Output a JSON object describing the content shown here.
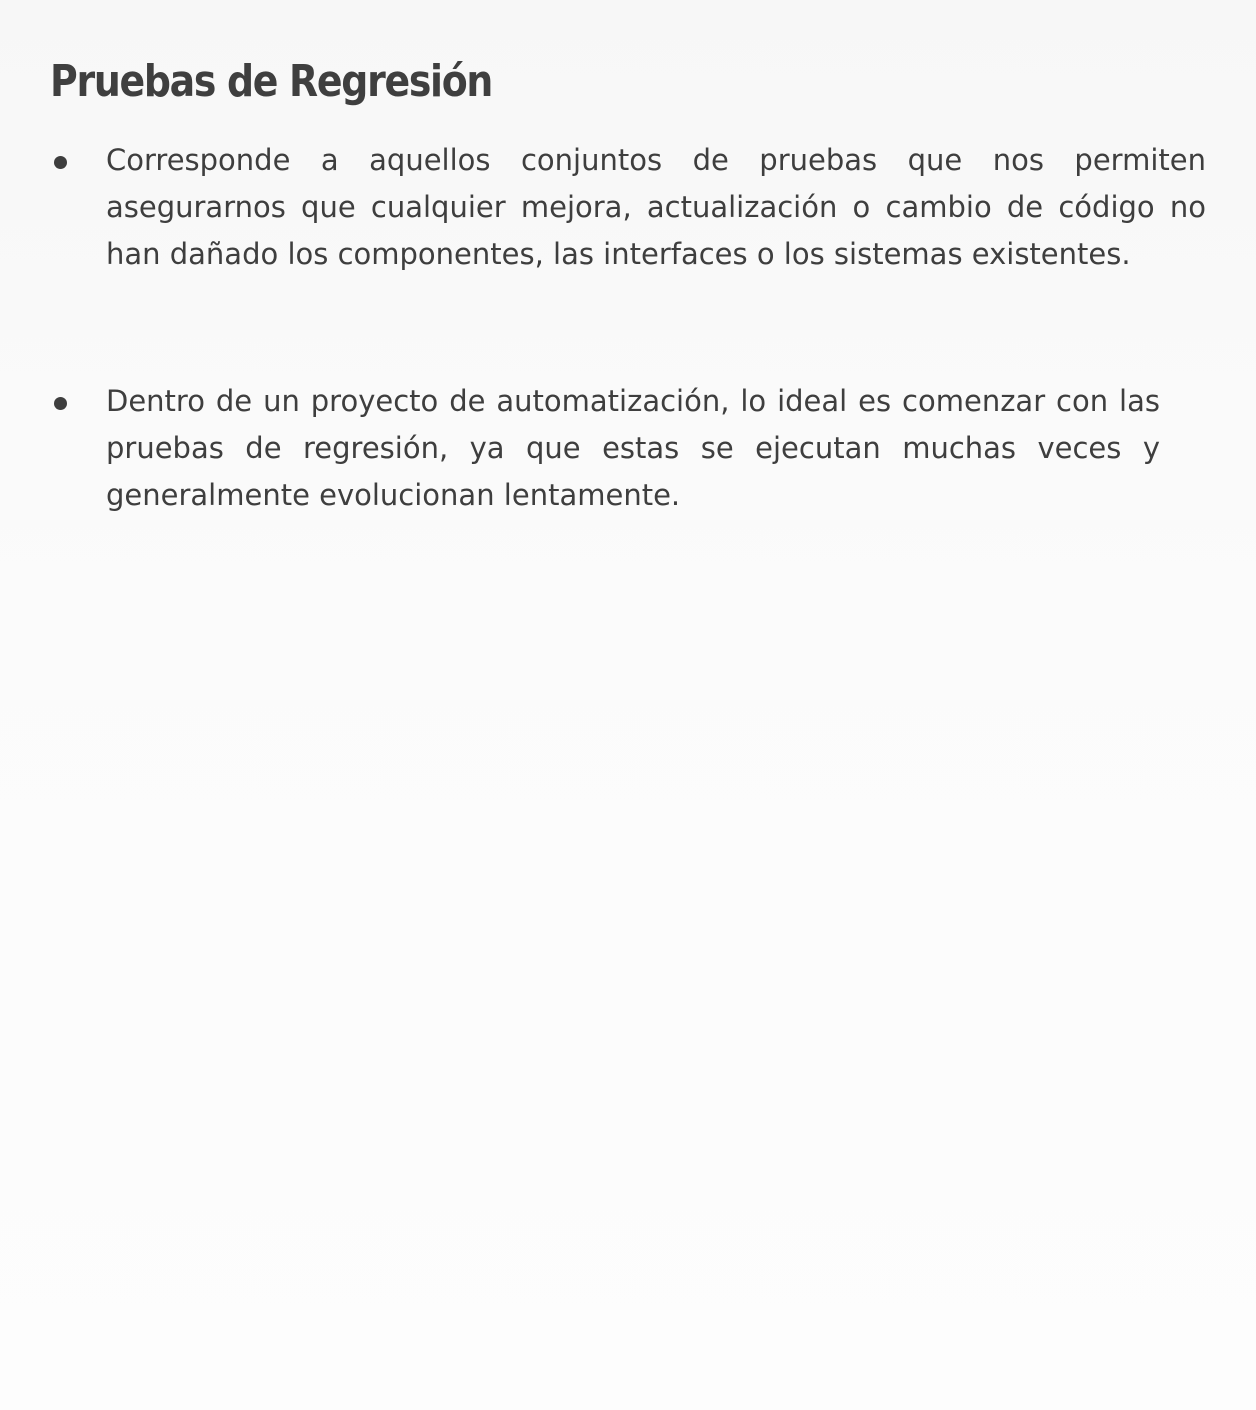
{
  "slide": {
    "title": "Pruebas de Regresión",
    "bullets": [
      {
        "text": "Corresponde a aquellos conjuntos de pruebas que nos permiten asegurarnos que cualquier mejora, actualización o cambio de código no han dañado los componentes, las interfaces o los sistemas existentes."
      },
      {
        "text": "Dentro de un proyecto de automatización, lo ideal es comenzar con las pruebas de regresión, ya que estas se ejecutan muchas veces y generalmente evolucionan lentamente."
      }
    ]
  },
  "colors": {
    "text": "#3e3e3e",
    "background": "#fdfdfd"
  }
}
